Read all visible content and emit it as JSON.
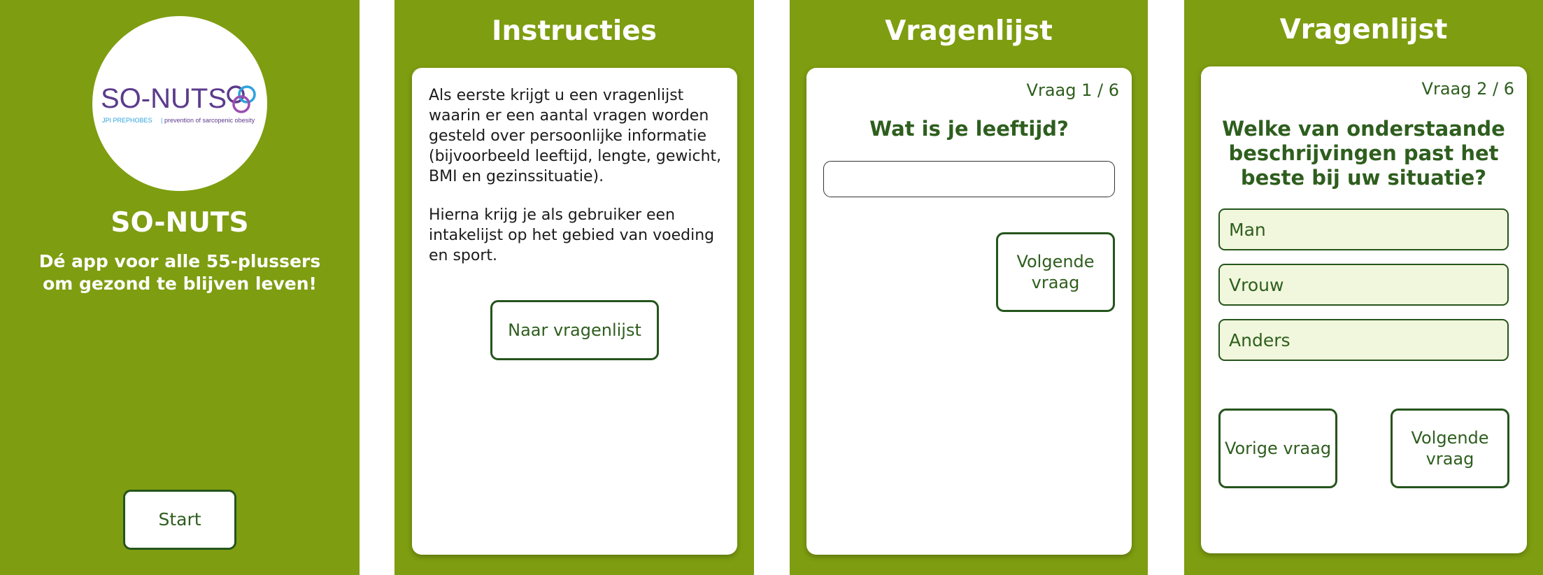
{
  "colors": {
    "background_green": "#7e9d10",
    "dark_green_text": "#2e5e1e",
    "button_border": "#25551c",
    "option_fill": "#f1f7dc",
    "logo_purple": "#5b3b8c",
    "logo_blue": "#2ea3dc"
  },
  "welcome": {
    "logo": {
      "wordmark": "SO-NUTS",
      "sub_left": "JPI PREPHOBES",
      "sub_right": "prevention of sarcopenic obesity"
    },
    "app_name": "SO-NUTS",
    "tagline": "Dé app voor alle 55-plussers om gezond te blijven leven!",
    "start_button": "Start"
  },
  "instructions": {
    "title": "Instructies",
    "paragraph_1": "Als eerste krijgt u een vragenlijst waarin er een aantal vragen worden gesteld over persoonlijke informatie (bijvoorbeeld leeftijd, lengte, gewicht, BMI en gezinssituatie).",
    "paragraph_2": "Hierna krijg je als gebruiker een intakelijst op het gebied van voeding en sport.",
    "button": "Naar vragenlijst"
  },
  "question_1": {
    "title": "Vragenlijst",
    "counter": "Vraag 1 / 6",
    "question": "Wat is je leeftijd?",
    "input_value": "",
    "next_button": "Volgende vraag"
  },
  "question_2": {
    "title": "Vragenlijst",
    "counter": "Vraag 2 / 6",
    "question": "Welke van onderstaande beschrijvingen past het beste bij uw situatie?",
    "options": [
      "Man",
      "Vrouw",
      "Anders"
    ],
    "prev_button": "Vorige vraag",
    "next_button": "Volgende vraag"
  }
}
